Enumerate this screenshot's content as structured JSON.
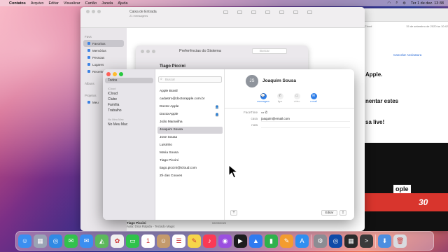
{
  "menubar": {
    "app_name": "Contatos",
    "items": [
      "Arquivo",
      "Editar",
      "Visualizar",
      "Cartão",
      "Janela",
      "Ajuda"
    ],
    "datetime": "Ter 1 de dez. 13:38"
  },
  "mail": {
    "title": "Caixa de Entrada",
    "message_count": "21 mensagens",
    "sidebar_section": "Favs",
    "sidebar_items": [
      "Favoritos",
      "Memórias",
      "Pessoas",
      "Lugares",
      "Recentes"
    ],
    "sidebar_section2": "Álbuns",
    "sidebar_section3": "Projetos",
    "sidebar_folder": "Meu",
    "footer_sender": "Tiago Piccini",
    "footer_subject": "Aula: Dica Rápida - Teclado Magic",
    "footer_date": "02/09/2020"
  },
  "safari": {
    "meta_left": "iCloud",
    "meta_right": "15 de setembro de 2020 às 10:42",
    "subscribe": "Cancelar Assinatura",
    "line1": "Apple.",
    "line2": "nentar estes",
    "line3": "sa live!",
    "promo_text": "ople",
    "promo_num": "30"
  },
  "prefs": {
    "title": "Preferências do Sistema",
    "search": "Buscar",
    "user": "Tiago Piccini"
  },
  "contacts": {
    "groups": {
      "all": "Todos",
      "section_icloud": "iCloud",
      "icloud_items": [
        "iCloud",
        "Clube",
        "Família",
        "Trabalho"
      ],
      "section_mac": "No Meu Mac",
      "mac_items": [
        "No Meu Mac"
      ]
    },
    "search_placeholder": "Buscar",
    "list": [
      {
        "name": "Apple Brasil",
        "badge": ""
      },
      {
        "name": "cadastro@doctorapple.com.br",
        "badge": ""
      },
      {
        "name": "Doctor Apple",
        "badge": "👤"
      },
      {
        "name": "DoctorApple",
        "badge": "👤"
      },
      {
        "name": "João Maravilha",
        "badge": ""
      },
      {
        "name": "Joaquim Sousa",
        "badge": ""
      },
      {
        "name": "Jose Sousa",
        "badge": ""
      },
      {
        "name": "Luisinho",
        "badge": ""
      },
      {
        "name": "Maria Sousa",
        "badge": ""
      },
      {
        "name": "Tiago Piccini",
        "badge": ""
      },
      {
        "name": "tiago.piccini@icloud.com",
        "badge": ""
      },
      {
        "name": "Zé das Couves",
        "badge": ""
      }
    ],
    "selected": {
      "initials": "JS",
      "name": "Joaquim Sousa",
      "actions": [
        {
          "label": "mensagem",
          "icon": "💬",
          "active": true
        },
        {
          "label": "ligar",
          "icon": "✆",
          "active": false
        },
        {
          "label": "vídeo",
          "icon": "▭",
          "active": false
        },
        {
          "label": "e-mail",
          "icon": "✉",
          "active": true
        }
      ],
      "fields": [
        {
          "key": "FaceTime",
          "value": "▭ ✆"
        },
        {
          "key": "casa",
          "value": "joaquim@email.com"
        },
        {
          "key": "nota",
          "value": ""
        }
      ]
    },
    "add_label": "+",
    "edit_label": "Editar",
    "share_label": "⇪"
  },
  "dock": {
    "apps": [
      {
        "name": "Finder",
        "color": "#3b8ff0",
        "glyph": "☺"
      },
      {
        "name": "Launchpad",
        "color": "#9aa3b5",
        "glyph": "▦"
      },
      {
        "name": "Safari",
        "color": "#2f8ae5",
        "glyph": "◎"
      },
      {
        "name": "Mensagens",
        "color": "#33c14d",
        "glyph": "✉"
      },
      {
        "name": "Mail",
        "color": "#3a8ef0",
        "glyph": "✉"
      },
      {
        "name": "Mapas",
        "color": "#5cb85c",
        "glyph": "◭"
      },
      {
        "name": "Fotos",
        "color": "#f0f0f0",
        "glyph": "✿"
      },
      {
        "name": "FaceTime",
        "color": "#2fc24b",
        "glyph": "▭"
      },
      {
        "name": "Calendário",
        "color": "#ffffff",
        "glyph": "1"
      },
      {
        "name": "Contatos",
        "color": "#c49a6c",
        "glyph": "☺"
      },
      {
        "name": "Lembretes",
        "color": "#ffffff",
        "glyph": "☰"
      },
      {
        "name": "Notas",
        "color": "#f6d54a",
        "glyph": "✎"
      },
      {
        "name": "Música",
        "color": "#fa3a55",
        "glyph": "♪"
      },
      {
        "name": "Podcasts",
        "color": "#9b4fe0",
        "glyph": "◉"
      },
      {
        "name": "TV",
        "color": "#1c1c1e",
        "glyph": "▶"
      },
      {
        "name": "Keynote",
        "color": "#2f7bf0",
        "glyph": "▲"
      },
      {
        "name": "Numbers",
        "color": "#2fb14c",
        "glyph": "▮"
      },
      {
        "name": "Pages",
        "color": "#f39c2f",
        "glyph": "✎"
      },
      {
        "name": "App Store",
        "color": "#2f8ff0",
        "glyph": "A"
      },
      {
        "name": "Preferências do Sistema",
        "color": "#8c8c93",
        "glyph": "⚙"
      },
      {
        "name": "Safari Preview",
        "color": "#0f4aa8",
        "glyph": "◎"
      },
      {
        "name": "Calculadora",
        "color": "#2a2a2a",
        "glyph": "▦"
      },
      {
        "name": "Terminal",
        "color": "#3a3a3a",
        "glyph": ">"
      },
      {
        "name": "Downloads",
        "color": "#4c8ee0",
        "glyph": "⬇"
      },
      {
        "name": "Lixo",
        "color": "#d9dbe0",
        "glyph": "🗑"
      }
    ]
  }
}
